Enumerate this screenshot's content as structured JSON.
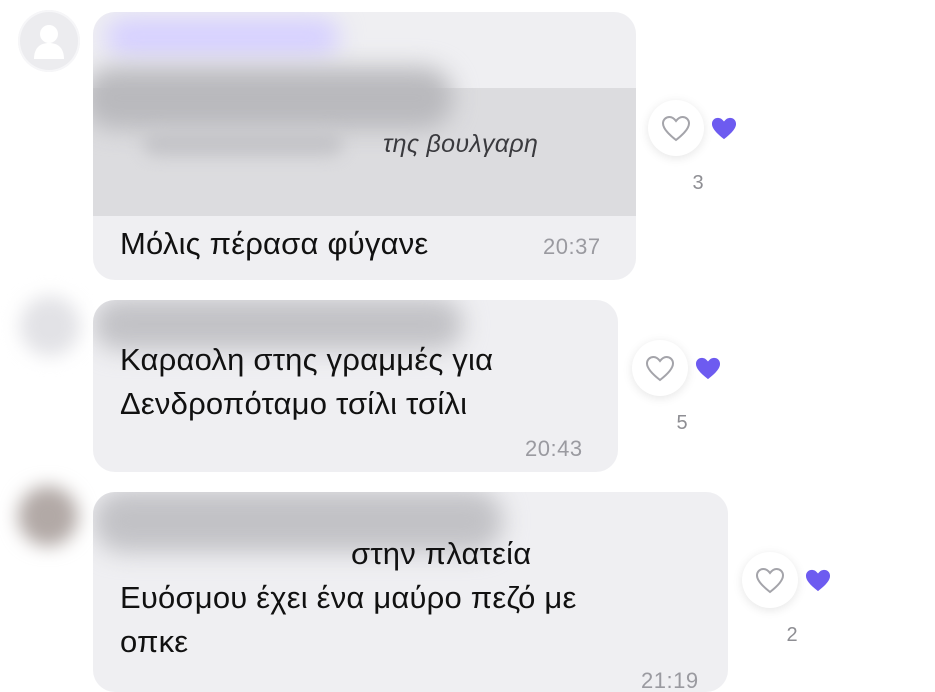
{
  "accent_color": "#6d5bf0",
  "messages": [
    {
      "quote_text": "της βουλγαρη",
      "text": "Μόλις πέρασα φύγανε",
      "time": "20:37",
      "reaction_icon": "heart-icon",
      "reaction_count": "3"
    },
    {
      "text": "Καραολη στης γραμμές για\nΔενδροπόταμο τσίλι τσίλι",
      "time": "20:43",
      "reaction_icon": "heart-icon",
      "reaction_count": "5"
    },
    {
      "text": "στην πλατεία\nΕυόσμου έχει ένα μαύρο πεζό με\nοπκε",
      "time": "21:19",
      "reaction_icon": "heart-icon",
      "reaction_count": "2"
    }
  ]
}
